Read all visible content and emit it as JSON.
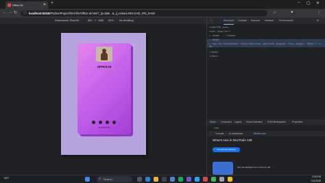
{
  "browser": {
    "tab_title": "Office ID",
    "url_host": "localhost:63340",
    "url_rest": "/PythonProject/html-file/Office-id.html?_ijt=3j8e...&_ij_reload=RELOAD_ON_SAVE"
  },
  "device_toolbar": {
    "device": "Dimensions: iPad Air",
    "width": "820",
    "height": "1180",
    "zoom": "50%",
    "throttle": "No throttling"
  },
  "card": {
    "title": "OFFICE ID",
    "footer": "By Saiirah info"
  },
  "devtools": {
    "tabs": [
      "Elements",
      "Console",
      "Sources",
      "Network",
      "Performance"
    ],
    "styles_tabs": [
      "Styles",
      "Computed",
      "Layout",
      "Event Listeners",
      "DOM Breakpoints",
      "Properties"
    ],
    "filter_placeholder": "Filter",
    "console_tabs": [
      "Console",
      "AI assistance",
      "What's new"
    ],
    "whats_new": "What's new in DevTools 138",
    "see_all": "See all new features",
    "promo": "See the highlights from Chrome 138",
    "code_lines": [
      "<!DOCTYPE html>",
      "<html lang=\"en\">",
      "▸ <head> ··· </head>",
      "▾ <body>",
      "▸ <div id=\"idcontainer\" style=\"position: absolute; display: flex; height: 100vh;\"> == $0",
      "</body>",
      "</html>"
    ]
  },
  "taskbar": {
    "search": "Search",
    "weather": "86°F",
    "time": "5:25 PM",
    "date": "7/11/2025"
  }
}
